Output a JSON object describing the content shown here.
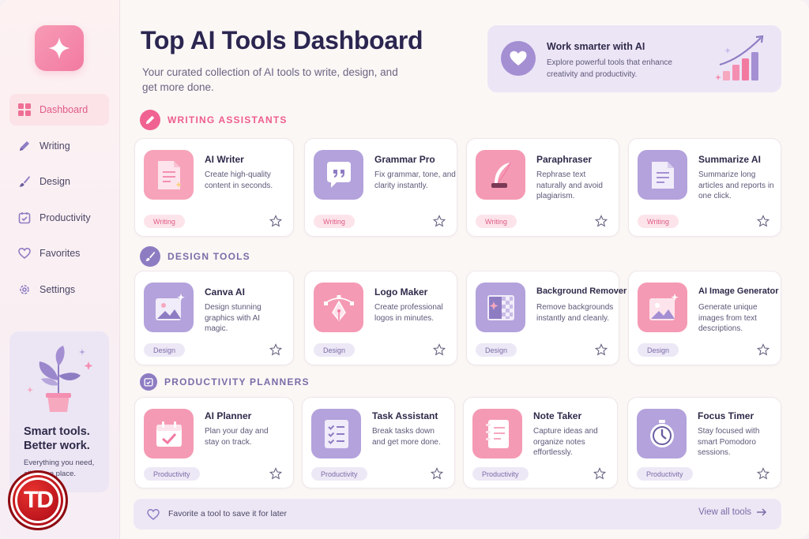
{
  "header": {
    "title": "Top AI Tools Dashboard",
    "subtitle": "Your curated collection of AI tools to write, design, and get more done."
  },
  "hero": {
    "title": "Work smarter with AI",
    "subtitle": "Explore powerful tools that enhance creativity and productivity."
  },
  "sidebar": {
    "items": [
      {
        "label": "Dashboard",
        "icon": "grid-icon",
        "active": true
      },
      {
        "label": "Writing",
        "icon": "pencil-icon"
      },
      {
        "label": "Design",
        "icon": "brush-icon"
      },
      {
        "label": "Productivity",
        "icon": "calendar-check-icon"
      },
      {
        "label": "Favorites",
        "icon": "heart-icon"
      },
      {
        "label": "Settings",
        "icon": "gear-icon"
      }
    ],
    "promo": {
      "title": "Smart tools. Better work.",
      "subtitle": "Everything you need, all in one place."
    }
  },
  "watermark": {
    "text": "TD"
  },
  "sections": [
    {
      "label": "WRITING ASSISTANTS",
      "icon": "pencil-icon",
      "color": "#f06292",
      "cards": [
        {
          "title": "AI Writer",
          "desc": "Create high-quality content in seconds.",
          "tag": "Writing",
          "icon": "document-icon"
        },
        {
          "title": "Grammar Pro",
          "desc": "Fix grammar, tone, and clarity instantly.",
          "tag": "Writing",
          "icon": "quote-icon"
        },
        {
          "title": "Paraphraser",
          "desc": "Rephrase text naturally and avoid plagiarism.",
          "tag": "Writing",
          "icon": "quill-icon"
        },
        {
          "title": "Summarize AI",
          "desc": "Summarize long articles and reports in one click.",
          "tag": "Writing",
          "icon": "summary-doc-icon"
        }
      ]
    },
    {
      "label": "DESIGN TOOLS",
      "icon": "brush-icon",
      "color": "#8e7cc3",
      "cards": [
        {
          "title": "Canva AI",
          "desc": "Design stunning graphics with AI magic.",
          "tag": "Design",
          "icon": "image-sparkle-icon"
        },
        {
          "title": "Logo Maker",
          "desc": "Create professional logos in minutes.",
          "tag": "Design",
          "icon": "pen-tool-icon"
        },
        {
          "title": "Background Remover",
          "desc": "Remove backgrounds instantly and cleanly.",
          "tag": "Design",
          "icon": "transparency-icon"
        },
        {
          "title": "AI Image Generator",
          "desc": "Generate unique images from text descriptions.",
          "tag": "Design",
          "icon": "image-sparkle-icon"
        }
      ]
    },
    {
      "label": "PRODUCTIVITY PLANNERS",
      "icon": "calendar-check-icon",
      "color": "#8e7cc3",
      "cards": [
        {
          "title": "AI Planner",
          "desc": "Plan your day and stay on track.",
          "tag": "Productivity",
          "icon": "calendar-check-icon"
        },
        {
          "title": "Task Assistant",
          "desc": "Break tasks down and get more done.",
          "tag": "Productivity",
          "icon": "checklist-icon"
        },
        {
          "title": "Note Taker",
          "desc": "Capture ideas and organize notes effortlessly.",
          "tag": "Productivity",
          "icon": "notebook-icon"
        },
        {
          "title": "Focus Timer",
          "desc": "Stay focused with smart Pomodoro sessions.",
          "tag": "Productivity",
          "icon": "stopwatch-icon"
        }
      ]
    }
  ],
  "footer": {
    "hint": "Favorite a tool to save it for later",
    "link": "View all tools"
  },
  "colors": {
    "pink": "#f27aa1",
    "purple": "#a48fd3",
    "navy": "#2b2650"
  }
}
